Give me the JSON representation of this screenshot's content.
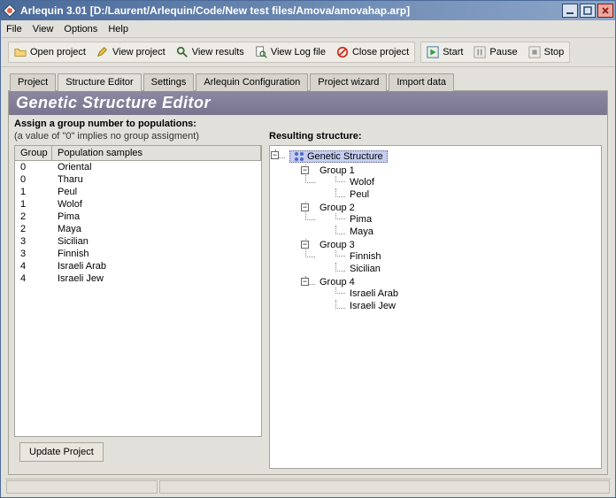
{
  "window": {
    "title": "Arlequin 3.01 [D:/Laurent/Arlequin/Code/New test files/Amova/amovahap.arp]"
  },
  "menu": {
    "file": "File",
    "view": "View",
    "options": "Options",
    "help": "Help"
  },
  "toolbar": {
    "open": "Open project",
    "viewp": "View project",
    "viewr": "View results",
    "viewlog": "View Log file",
    "close": "Close project",
    "start": "Start",
    "pause": "Pause",
    "stop": "Stop"
  },
  "tabs": {
    "project": "Project",
    "structure": "Structure Editor",
    "settings": "Settings",
    "config": "Arlequin Configuration",
    "wizard": "Project wizard",
    "import": "Import data"
  },
  "editor": {
    "title": "Genetic Structure Editor",
    "instr": "Assign a group number to populations:",
    "sub": "(a value of \"0\" implies no group assigment)",
    "cols": {
      "group": "Group",
      "pop": "Population samples"
    },
    "rows": [
      {
        "g": "0",
        "p": "Oriental"
      },
      {
        "g": "0",
        "p": "Tharu"
      },
      {
        "g": "1",
        "p": "Peul"
      },
      {
        "g": "1",
        "p": "Wolof"
      },
      {
        "g": "2",
        "p": "Pima"
      },
      {
        "g": "2",
        "p": "Maya"
      },
      {
        "g": "3",
        "p": "Sicilian"
      },
      {
        "g": "3",
        "p": "Finnish"
      },
      {
        "g": "4",
        "p": "Israeli Arab"
      },
      {
        "g": "4",
        "p": "Israeli Jew"
      }
    ],
    "update": "Update Project"
  },
  "result": {
    "label": "Resulting structure:",
    "root": "Genetic Structure",
    "groups": [
      {
        "name": "Group 1",
        "pops": [
          "Wolof",
          "Peul"
        ]
      },
      {
        "name": "Group 2",
        "pops": [
          "Pima",
          "Maya"
        ]
      },
      {
        "name": "Group 3",
        "pops": [
          "Finnish",
          "Sicilian"
        ]
      },
      {
        "name": "Group 4",
        "pops": [
          "Israeli Arab",
          "Israeli Jew"
        ]
      }
    ]
  }
}
